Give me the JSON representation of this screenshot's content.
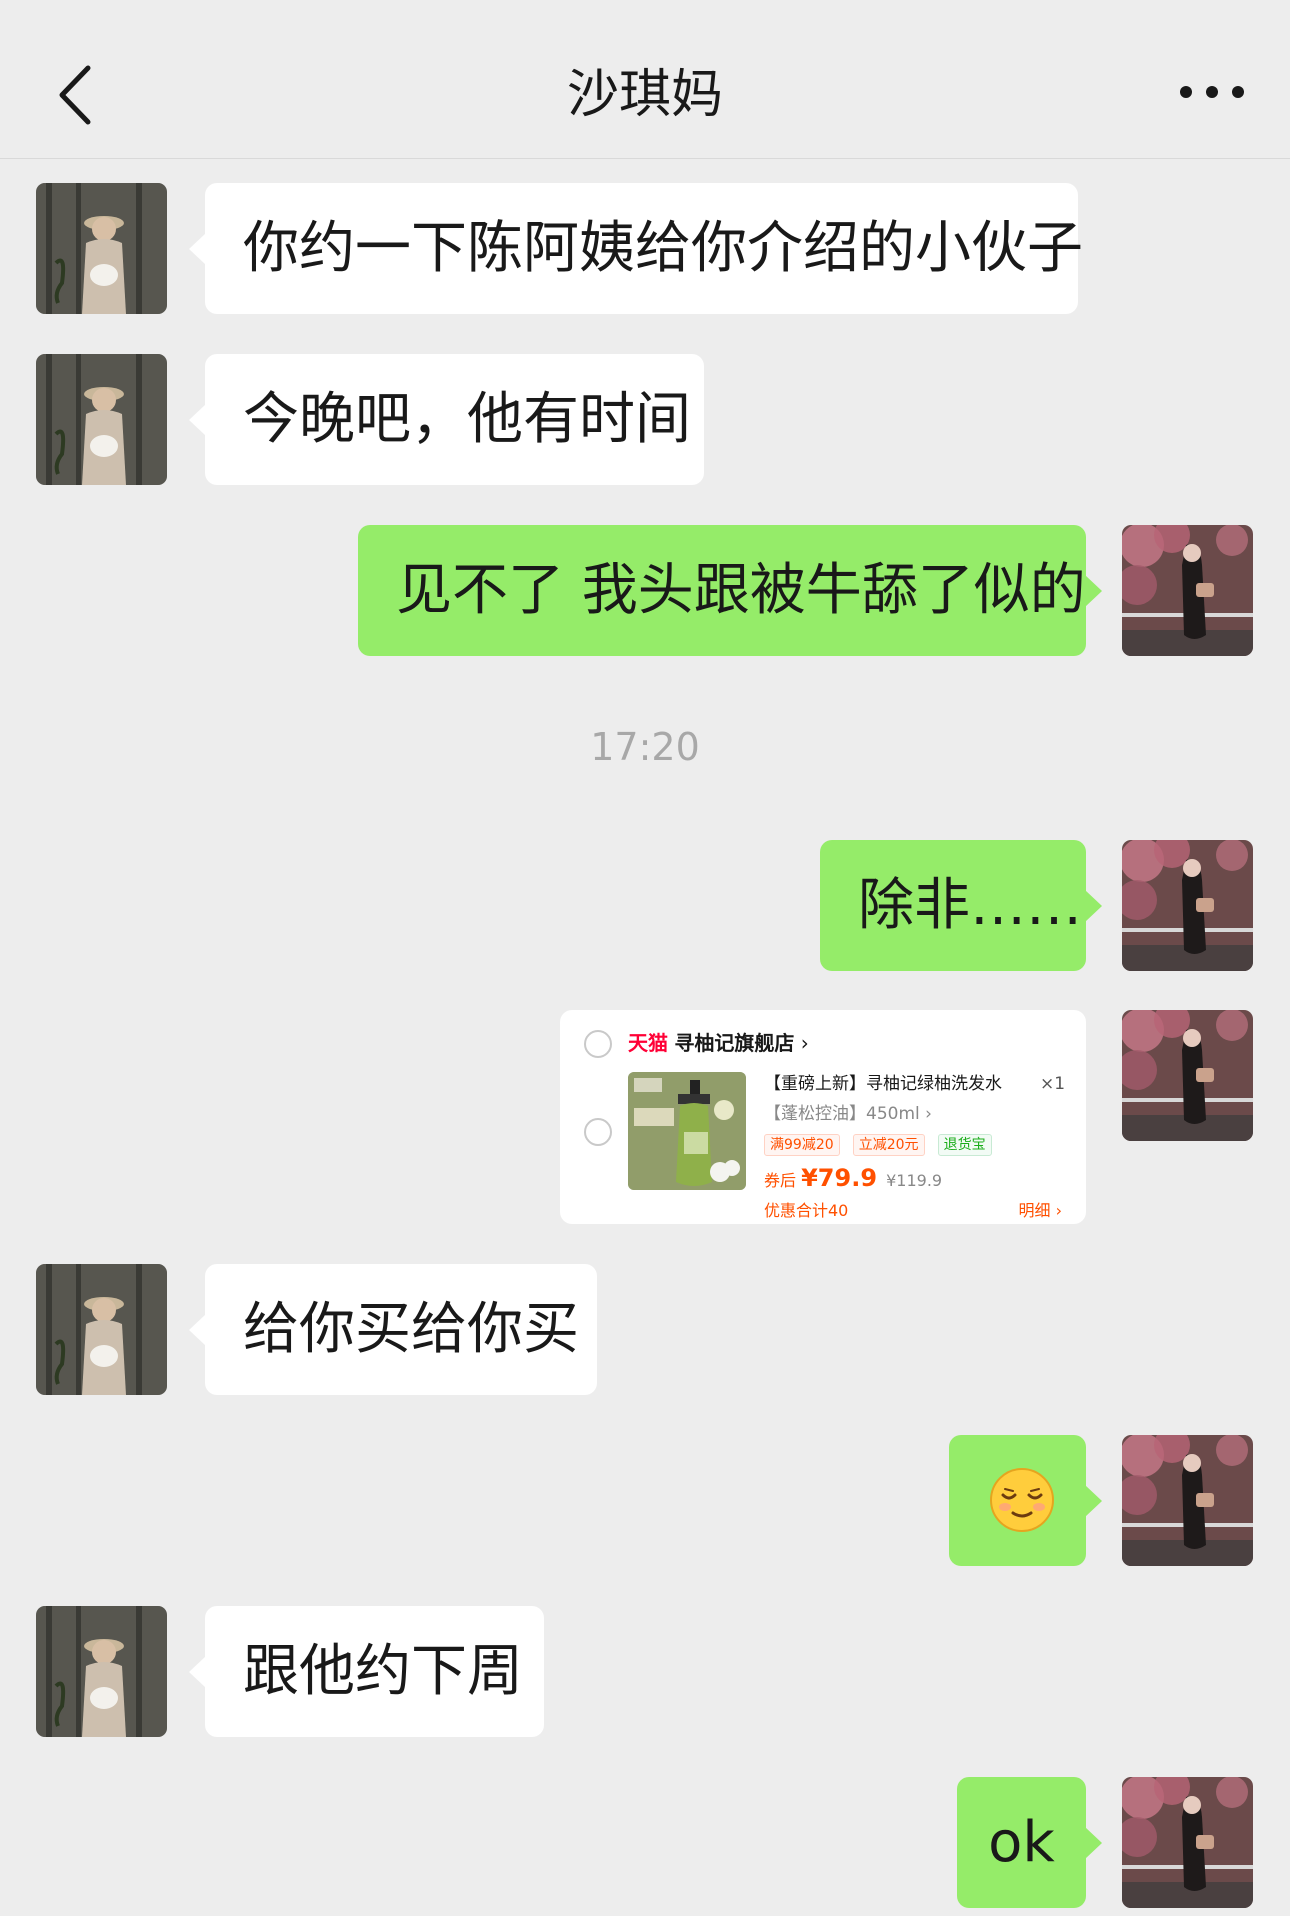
{
  "header": {
    "title": "沙琪妈",
    "back_icon": "chevron-left-icon",
    "more_icon": "more-dots-icon"
  },
  "messages": [
    {
      "side": "left",
      "text": "你约一下陈阿姨给你介绍的小伙子"
    },
    {
      "side": "left",
      "text": "今晚吧，他有时间"
    },
    {
      "side": "right",
      "text": "见不了 我头跟被牛舔了似的"
    },
    {
      "side": "right",
      "text": "除非……"
    },
    {
      "side": "left",
      "text": "给你买给你买"
    },
    {
      "side": "right",
      "emoji": "relieved-face-emoji"
    },
    {
      "side": "left",
      "text": "跟他约下周"
    },
    {
      "side": "right",
      "text": "ok"
    }
  ],
  "timestamp": "17:20",
  "product_card": {
    "platform": "天猫",
    "store": "寻柚记旗舰店",
    "store_arrow": "›",
    "name": "【重磅上新】寻柚记绿柚洗发水",
    "quantity": "×1",
    "spec": "【蓬松控油】450ml ›",
    "tags": [
      "满99减20",
      "立减20元",
      "退货宝"
    ],
    "price_prefix": "券后",
    "price": "¥79.9",
    "original_price": "¥119.9",
    "discount": "优惠合计40",
    "detail": "明细 ›"
  },
  "colors": {
    "background": "#ededed",
    "left_bubble": "#ffffff",
    "right_bubble": "#95ec69",
    "tmall_red": "#ff0036",
    "price_orange": "#ff5000"
  }
}
